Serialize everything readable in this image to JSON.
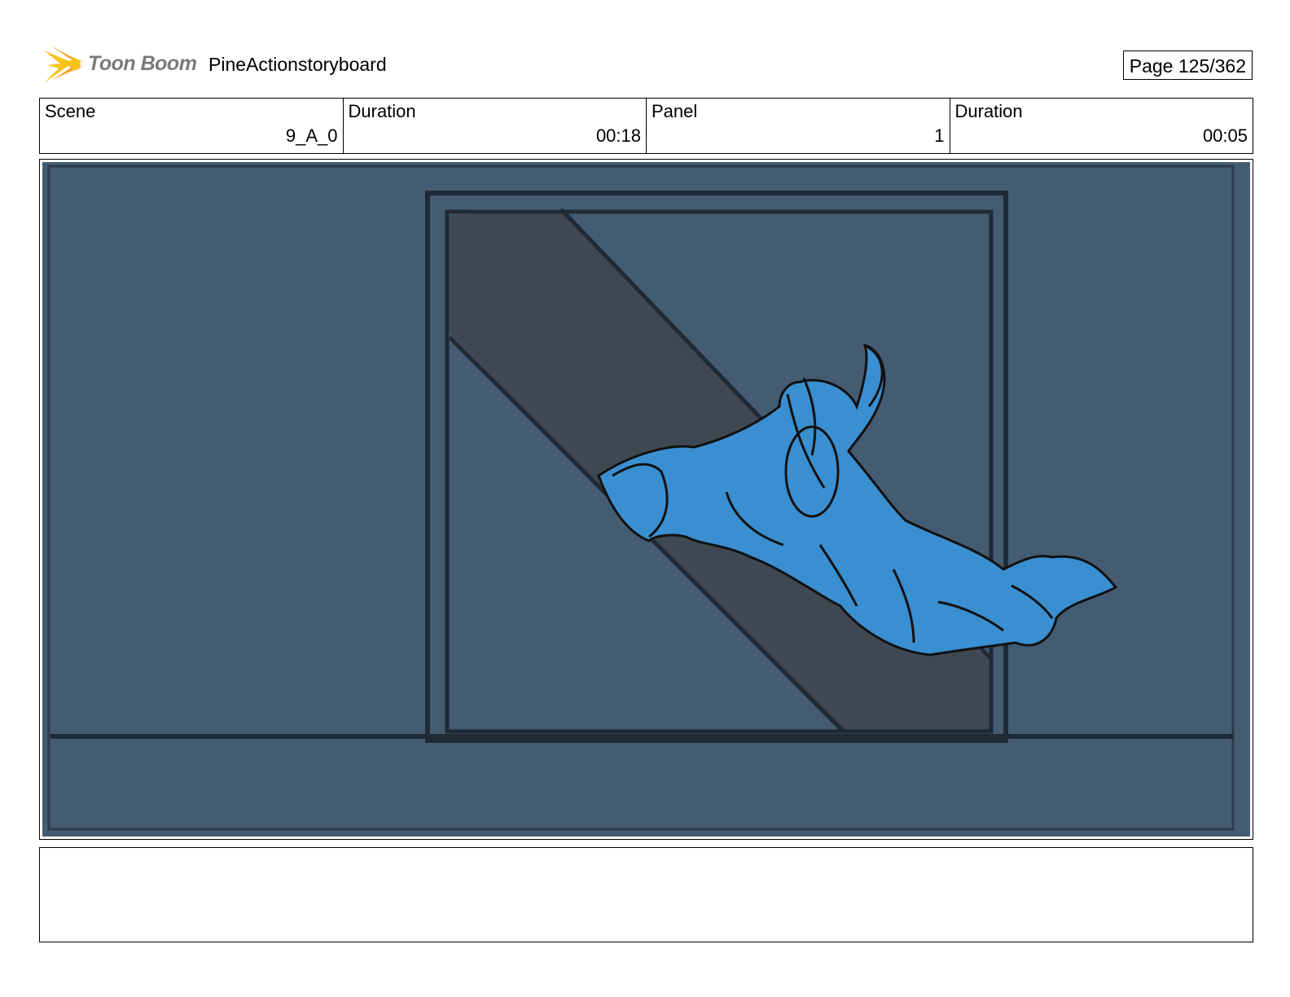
{
  "header": {
    "logo_text": "Toon Boom",
    "project_title": "PineActionstoryboard",
    "page_label": "Page 125/362"
  },
  "info": {
    "scene_label": "Scene",
    "scene_value": "9_A_0",
    "scene_duration_label": "Duration",
    "scene_duration_value": "00:18",
    "panel_label": "Panel",
    "panel_value": "1",
    "panel_duration_label": "Duration",
    "panel_duration_value": "00:05"
  },
  "colors": {
    "background_blue": "#445c72",
    "character_blue": "#3a8fd0",
    "shadow_slab": "#3f4852",
    "ink": "#111111",
    "logo_yellow": "#f7c21a"
  }
}
